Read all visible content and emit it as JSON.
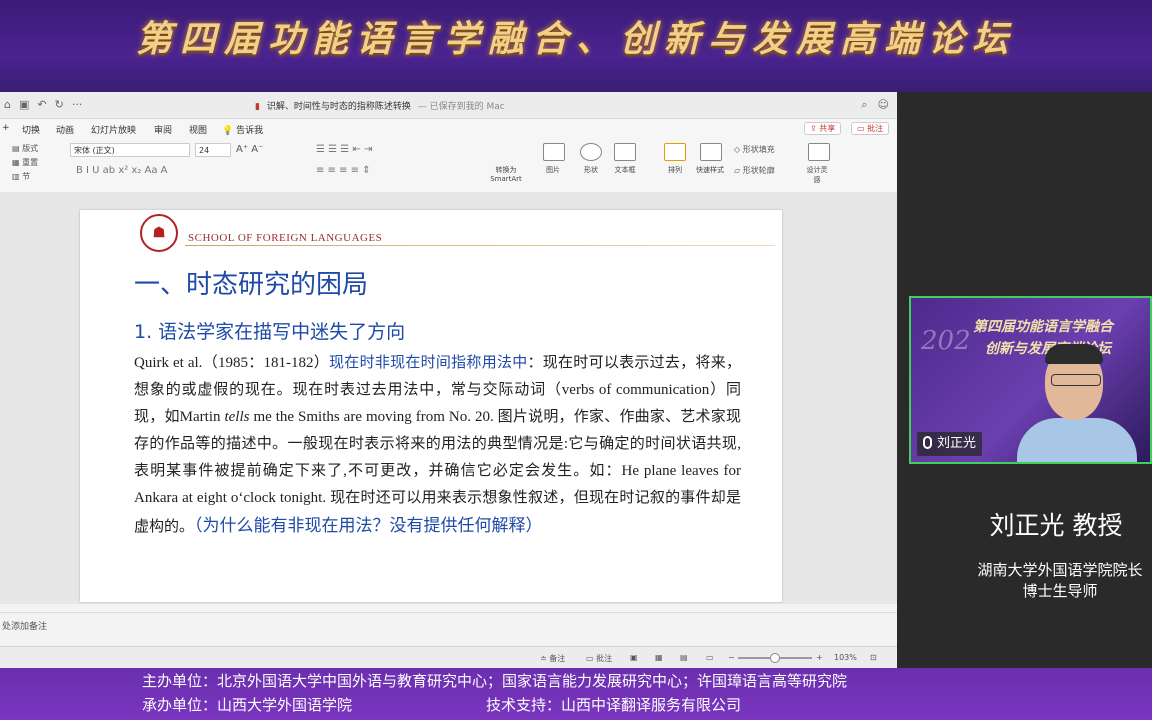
{
  "banner": {
    "title": "第四届功能语言学融合、创新与发展高端论坛"
  },
  "app": {
    "doc_title": "识解、时间性与时态的指称陈述转换",
    "save_status": "— 已保存到我的 Mac",
    "menu": [
      "切换",
      "动画",
      "幻灯片放映",
      "审阅",
      "视图",
      "告诉我"
    ],
    "share_label": "共享",
    "comment_label": "批注",
    "ribbon": {
      "font_name": "宋体 (正文)",
      "font_size": "24",
      "layout_label": "版式",
      "reset_label": "重置",
      "section_label": "节",
      "convert_label": "转换为 SmartArt",
      "picture_label": "图片",
      "shape_label": "形状",
      "textbox_label": "文本框",
      "arrange_label": "排列",
      "quickstyle_label": "快速样式",
      "shape_fill_label": "形状填充",
      "shape_outline_label": "形状轮廓",
      "design_label": "设计灵感"
    },
    "notes_placeholder": "处添加备注",
    "status": {
      "notes_btn": "备注",
      "comments_btn": "批注",
      "zoom": "103%"
    }
  },
  "slide": {
    "school": "SCHOOL OF FOREIGN LANGUAGES",
    "section_title": "一、时态研究的困局",
    "subtitle": "1. 语法学家在描写中迷失了方向",
    "para_lead": "Quirk et al.（1985：181-182）",
    "para_blue": "现在时非现在时间指称用法中",
    "para_rest": "：现在时可以表示过去，将来，想象的或虚假的现在。现在时表过去用法中，常与交际动词（verbs of communication）同现，如Martin ",
    "para_italic": "tells",
    "para_rest2": " me the Smiths are moving from No. 20. 图片说明，作家、作曲家、艺术家现存的作品等的描述中。一般现在时表示将来的用法的典型情况是:它与确定的时间状语共现,表明某事件被提前确定下来了,不可更改，并确信它必定会发生。如：He plane leaves for Ankara at eight o‘clock tonight. 现在时还可以用来表示想象性叙述，但现在时记叙的事件却是虚构的。",
    "question": "（为什么能有非现在用法？没有提供任何解释）"
  },
  "video": {
    "bg_title_line1": "第四届功能语言学融合",
    "bg_title_line2": "创新与发展高端论坛",
    "bg_year": "202",
    "participant_name": "刘正光"
  },
  "speaker": {
    "name": "刘正光  教授",
    "role_line1": "湖南大学外国语学院院长",
    "role_line2": "博士生导师"
  },
  "footer": {
    "host": "主办单位：北京外国语大学中国外语与教育研究中心；国家语言能力发展研究中心；许国璋语言高等研究院",
    "organizer": "承办单位：山西大学外国语学院",
    "tech": "技术支持：山西中译翻译服务有限公司"
  }
}
